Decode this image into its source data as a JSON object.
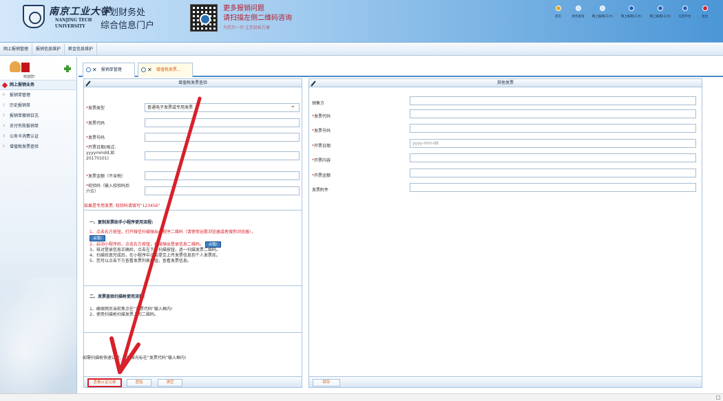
{
  "header": {
    "logo_cn": "南京工业大学",
    "logo_en_line1": "NANJING TECH",
    "logo_en_line2": "UNIVERSITY",
    "title_line1": "计划财务处",
    "title_line2": "综合信息门户",
    "promo_line1": "更多报销问题",
    "promo_line2": "请扫描左侧二维码咨询",
    "promo_line3": "为您只一只 让您轻松方便",
    "nav": [
      {
        "label": "首页",
        "color": "gold"
      },
      {
        "label": "财务查询",
        "color": "light"
      },
      {
        "label": "网上报销(工大)",
        "color": "light"
      },
      {
        "label": "网上报销(工大)",
        "color": "blue"
      },
      {
        "label": "网上报销(工大)",
        "color": "blue"
      },
      {
        "label": "信息平台",
        "color": "blue"
      },
      {
        "label": "退出",
        "color": "red"
      }
    ]
  },
  "menubar": {
    "tabs": [
      "网上报销管理",
      "报销信息维护",
      "薪金信息维护"
    ]
  },
  "sidebar": {
    "user_label": "欢迎您!",
    "section": "网上报销业务",
    "items": [
      {
        "num": "0",
        "label": "报销单管理"
      },
      {
        "num": "1",
        "label": "历史报销单"
      },
      {
        "num": "2",
        "label": "报销单撤销日志"
      },
      {
        "num": "3",
        "label": "支付失败报销单"
      },
      {
        "num": "4",
        "label": "公务卡消费认证"
      },
      {
        "num": "5",
        "label": "增值税发票查验"
      }
    ]
  },
  "page_tabs": [
    {
      "label": "报销单管理"
    },
    {
      "label": "增值税发票..."
    }
  ],
  "left_panel": {
    "title": "增值税发票查验",
    "fields": {
      "invoice_type_label": "发票类型",
      "invoice_type_value": "普通电子发票或专用发票",
      "invoice_code_label": "发票代码",
      "invoice_number_label": "发票号码",
      "invoice_date_label_1": "开票日期(格式:",
      "invoice_date_label_2": "yyyymmdd,如",
      "invoice_date_label_3": "20170101)",
      "amount_label": "发票金额（不含税）",
      "verify_label_1": "校验码（输入校验码后",
      "verify_label_2": "六位）"
    },
    "hint": "如果是专用发票, 校验码请填写\"123456\"",
    "instr1_title": "一、复制发票助手小程序使用流程:",
    "instr1_step1": "1、点击右方按钮，打开微信扫描弹出小程序二维码（请使用谷歌浏览器或者搜狗浏览器），",
    "instr1_btn": "点我!",
    "instr1_step2": "2、启动小程序后，点击右方按钮，扫描弹出登录信息二维码。",
    "instr1_btn2": "点我!",
    "instr1_step3": "3、核对登录信息正确后，点击左下方扫描按钮，逐一扫描发票二维码。",
    "instr1_step4": "4、扫描验真完成后，在小程序中点击提交上传发票信息到个人发票库。",
    "instr1_step5": "5、您可以点击下方查看发票列表按钮，查看发票信息。",
    "instr2_title": "二、发票查验扫描枪使用流程:",
    "instr2_step1": "1、确保网页当前焦点在“发票代码”输入框内!",
    "instr2_step2": "2、使用扫描枪扫描发票上的二维码。",
    "bottom_note": "如需扫描枪快速认证, 请确保光标在“发票代码”输入框内!",
    "buttons": {
      "query_record": "查看认证记录",
      "verify": "查验",
      "clear": "清空"
    }
  },
  "right_panel": {
    "title": "其他发票",
    "fields": [
      {
        "label": "销售方",
        "required": false,
        "placeholder": ""
      },
      {
        "label": "发票代码",
        "required": true,
        "placeholder": ""
      },
      {
        "label": "发票号码",
        "required": true,
        "placeholder": ""
      },
      {
        "label": "开票日期",
        "required": true,
        "placeholder": "yyyy-mm-dd"
      },
      {
        "label": "开票内容",
        "required": true,
        "placeholder": ""
      },
      {
        "label": "开票金额",
        "required": true,
        "placeholder": ""
      },
      {
        "label": "发票附件",
        "required": false,
        "placeholder": ""
      }
    ],
    "save_button": "保存"
  },
  "colors": {
    "accent_blue": "#4a89c7",
    "annotation_red": "#d8202a",
    "button_text": "#d9621a"
  }
}
